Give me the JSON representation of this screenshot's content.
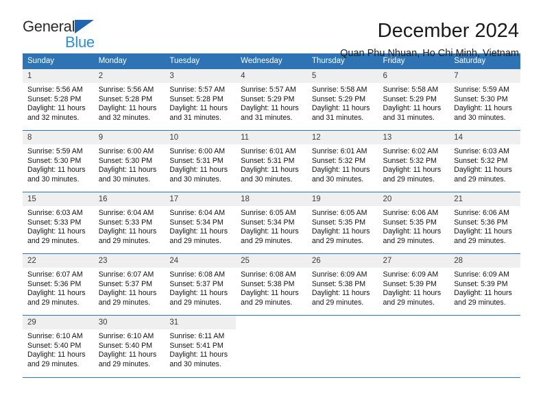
{
  "brand": {
    "name_top": "General",
    "name_bottom": "Blue",
    "triangle_icon": "triangle-icon",
    "accent_blue": "#2b8ede",
    "logo_blue": "#1f66b0"
  },
  "header": {
    "title": "December 2024",
    "subtitle": "Quan Phu Nhuan, Ho Chi Minh, Vietnam"
  },
  "theme": {
    "header_bg": "#2e74b5",
    "header_text": "#ffffff",
    "daynum_bg": "#efefef",
    "rule": "#2e74b5"
  },
  "weekday_headers": [
    "Sunday",
    "Monday",
    "Tuesday",
    "Wednesday",
    "Thursday",
    "Friday",
    "Saturday"
  ],
  "weeks": [
    [
      {
        "day": "1",
        "sunrise": "Sunrise: 5:56 AM",
        "sunset": "Sunset: 5:28 PM",
        "daylight_line1": "Daylight: 11 hours",
        "daylight_line2": "and 32 minutes."
      },
      {
        "day": "2",
        "sunrise": "Sunrise: 5:56 AM",
        "sunset": "Sunset: 5:28 PM",
        "daylight_line1": "Daylight: 11 hours",
        "daylight_line2": "and 32 minutes."
      },
      {
        "day": "3",
        "sunrise": "Sunrise: 5:57 AM",
        "sunset": "Sunset: 5:28 PM",
        "daylight_line1": "Daylight: 11 hours",
        "daylight_line2": "and 31 minutes."
      },
      {
        "day": "4",
        "sunrise": "Sunrise: 5:57 AM",
        "sunset": "Sunset: 5:29 PM",
        "daylight_line1": "Daylight: 11 hours",
        "daylight_line2": "and 31 minutes."
      },
      {
        "day": "5",
        "sunrise": "Sunrise: 5:58 AM",
        "sunset": "Sunset: 5:29 PM",
        "daylight_line1": "Daylight: 11 hours",
        "daylight_line2": "and 31 minutes."
      },
      {
        "day": "6",
        "sunrise": "Sunrise: 5:58 AM",
        "sunset": "Sunset: 5:29 PM",
        "daylight_line1": "Daylight: 11 hours",
        "daylight_line2": "and 31 minutes."
      },
      {
        "day": "7",
        "sunrise": "Sunrise: 5:59 AM",
        "sunset": "Sunset: 5:30 PM",
        "daylight_line1": "Daylight: 11 hours",
        "daylight_line2": "and 30 minutes."
      }
    ],
    [
      {
        "day": "8",
        "sunrise": "Sunrise: 5:59 AM",
        "sunset": "Sunset: 5:30 PM",
        "daylight_line1": "Daylight: 11 hours",
        "daylight_line2": "and 30 minutes."
      },
      {
        "day": "9",
        "sunrise": "Sunrise: 6:00 AM",
        "sunset": "Sunset: 5:30 PM",
        "daylight_line1": "Daylight: 11 hours",
        "daylight_line2": "and 30 minutes."
      },
      {
        "day": "10",
        "sunrise": "Sunrise: 6:00 AM",
        "sunset": "Sunset: 5:31 PM",
        "daylight_line1": "Daylight: 11 hours",
        "daylight_line2": "and 30 minutes."
      },
      {
        "day": "11",
        "sunrise": "Sunrise: 6:01 AM",
        "sunset": "Sunset: 5:31 PM",
        "daylight_line1": "Daylight: 11 hours",
        "daylight_line2": "and 30 minutes."
      },
      {
        "day": "12",
        "sunrise": "Sunrise: 6:01 AM",
        "sunset": "Sunset: 5:32 PM",
        "daylight_line1": "Daylight: 11 hours",
        "daylight_line2": "and 30 minutes."
      },
      {
        "day": "13",
        "sunrise": "Sunrise: 6:02 AM",
        "sunset": "Sunset: 5:32 PM",
        "daylight_line1": "Daylight: 11 hours",
        "daylight_line2": "and 29 minutes."
      },
      {
        "day": "14",
        "sunrise": "Sunrise: 6:03 AM",
        "sunset": "Sunset: 5:32 PM",
        "daylight_line1": "Daylight: 11 hours",
        "daylight_line2": "and 29 minutes."
      }
    ],
    [
      {
        "day": "15",
        "sunrise": "Sunrise: 6:03 AM",
        "sunset": "Sunset: 5:33 PM",
        "daylight_line1": "Daylight: 11 hours",
        "daylight_line2": "and 29 minutes."
      },
      {
        "day": "16",
        "sunrise": "Sunrise: 6:04 AM",
        "sunset": "Sunset: 5:33 PM",
        "daylight_line1": "Daylight: 11 hours",
        "daylight_line2": "and 29 minutes."
      },
      {
        "day": "17",
        "sunrise": "Sunrise: 6:04 AM",
        "sunset": "Sunset: 5:34 PM",
        "daylight_line1": "Daylight: 11 hours",
        "daylight_line2": "and 29 minutes."
      },
      {
        "day": "18",
        "sunrise": "Sunrise: 6:05 AM",
        "sunset": "Sunset: 5:34 PM",
        "daylight_line1": "Daylight: 11 hours",
        "daylight_line2": "and 29 minutes."
      },
      {
        "day": "19",
        "sunrise": "Sunrise: 6:05 AM",
        "sunset": "Sunset: 5:35 PM",
        "daylight_line1": "Daylight: 11 hours",
        "daylight_line2": "and 29 minutes."
      },
      {
        "day": "20",
        "sunrise": "Sunrise: 6:06 AM",
        "sunset": "Sunset: 5:35 PM",
        "daylight_line1": "Daylight: 11 hours",
        "daylight_line2": "and 29 minutes."
      },
      {
        "day": "21",
        "sunrise": "Sunrise: 6:06 AM",
        "sunset": "Sunset: 5:36 PM",
        "daylight_line1": "Daylight: 11 hours",
        "daylight_line2": "and 29 minutes."
      }
    ],
    [
      {
        "day": "22",
        "sunrise": "Sunrise: 6:07 AM",
        "sunset": "Sunset: 5:36 PM",
        "daylight_line1": "Daylight: 11 hours",
        "daylight_line2": "and 29 minutes."
      },
      {
        "day": "23",
        "sunrise": "Sunrise: 6:07 AM",
        "sunset": "Sunset: 5:37 PM",
        "daylight_line1": "Daylight: 11 hours",
        "daylight_line2": "and 29 minutes."
      },
      {
        "day": "24",
        "sunrise": "Sunrise: 6:08 AM",
        "sunset": "Sunset: 5:37 PM",
        "daylight_line1": "Daylight: 11 hours",
        "daylight_line2": "and 29 minutes."
      },
      {
        "day": "25",
        "sunrise": "Sunrise: 6:08 AM",
        "sunset": "Sunset: 5:38 PM",
        "daylight_line1": "Daylight: 11 hours",
        "daylight_line2": "and 29 minutes."
      },
      {
        "day": "26",
        "sunrise": "Sunrise: 6:09 AM",
        "sunset": "Sunset: 5:38 PM",
        "daylight_line1": "Daylight: 11 hours",
        "daylight_line2": "and 29 minutes."
      },
      {
        "day": "27",
        "sunrise": "Sunrise: 6:09 AM",
        "sunset": "Sunset: 5:39 PM",
        "daylight_line1": "Daylight: 11 hours",
        "daylight_line2": "and 29 minutes."
      },
      {
        "day": "28",
        "sunrise": "Sunrise: 6:09 AM",
        "sunset": "Sunset: 5:39 PM",
        "daylight_line1": "Daylight: 11 hours",
        "daylight_line2": "and 29 minutes."
      }
    ],
    [
      {
        "day": "29",
        "sunrise": "Sunrise: 6:10 AM",
        "sunset": "Sunset: 5:40 PM",
        "daylight_line1": "Daylight: 11 hours",
        "daylight_line2": "and 29 minutes."
      },
      {
        "day": "30",
        "sunrise": "Sunrise: 6:10 AM",
        "sunset": "Sunset: 5:40 PM",
        "daylight_line1": "Daylight: 11 hours",
        "daylight_line2": "and 29 minutes."
      },
      {
        "day": "31",
        "sunrise": "Sunrise: 6:11 AM",
        "sunset": "Sunset: 5:41 PM",
        "daylight_line1": "Daylight: 11 hours",
        "daylight_line2": "and 30 minutes."
      },
      {
        "day": "",
        "sunrise": "",
        "sunset": "",
        "daylight_line1": "",
        "daylight_line2": ""
      },
      {
        "day": "",
        "sunrise": "",
        "sunset": "",
        "daylight_line1": "",
        "daylight_line2": ""
      },
      {
        "day": "",
        "sunrise": "",
        "sunset": "",
        "daylight_line1": "",
        "daylight_line2": ""
      },
      {
        "day": "",
        "sunrise": "",
        "sunset": "",
        "daylight_line1": "",
        "daylight_line2": ""
      }
    ]
  ]
}
